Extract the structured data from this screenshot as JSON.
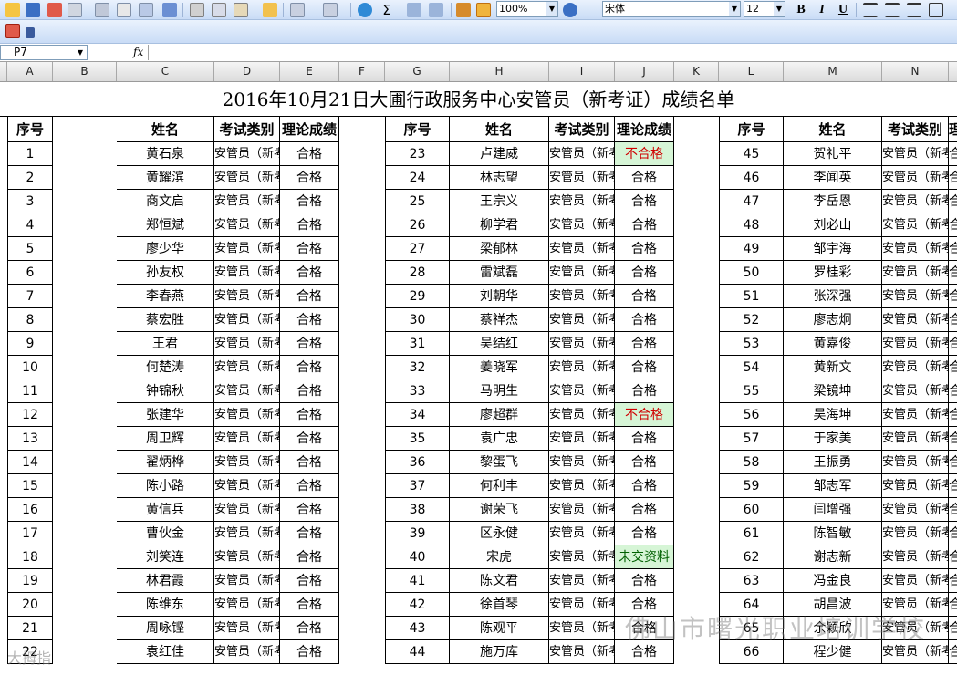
{
  "toolbar": {
    "zoom": "100%",
    "font_name": "宋体",
    "font_size": "12",
    "bold": "B",
    "italic": "I",
    "underline": "U",
    "sum": "Σ"
  },
  "formula_bar": {
    "cell_ref": "P7",
    "fx": "fx",
    "value": ""
  },
  "columns": [
    "A",
    "B",
    "C",
    "D",
    "E",
    "F",
    "G",
    "H",
    "I",
    "J",
    "K",
    "L",
    "M",
    "N"
  ],
  "sheet": {
    "title": "2016年10月21日大圃行政服务中心安管员（新考证）成绩名单",
    "headers": {
      "no": "序号",
      "name": "姓名",
      "category": "考试类别",
      "score": "理论成绩"
    },
    "category": "安管员（新考证）",
    "block1": [
      {
        "no": "1",
        "name": "黄石泉",
        "score": "合格"
      },
      {
        "no": "2",
        "name": "黄耀滨",
        "score": "合格"
      },
      {
        "no": "3",
        "name": "商文启",
        "score": "合格"
      },
      {
        "no": "4",
        "name": "郑恒斌",
        "score": "合格"
      },
      {
        "no": "5",
        "name": "廖少华",
        "score": "合格"
      },
      {
        "no": "6",
        "name": "孙友权",
        "score": "合格"
      },
      {
        "no": "7",
        "name": "李春燕",
        "score": "合格"
      },
      {
        "no": "8",
        "name": "蔡宏胜",
        "score": "合格"
      },
      {
        "no": "9",
        "name": "王君",
        "score": "合格"
      },
      {
        "no": "10",
        "name": "何楚涛",
        "score": "合格"
      },
      {
        "no": "11",
        "name": "钟锦秋",
        "score": "合格"
      },
      {
        "no": "12",
        "name": "张建华",
        "score": "合格"
      },
      {
        "no": "13",
        "name": "周卫辉",
        "score": "合格"
      },
      {
        "no": "14",
        "name": "翟炳桦",
        "score": "合格"
      },
      {
        "no": "15",
        "name": "陈小路",
        "score": "合格"
      },
      {
        "no": "16",
        "name": "黄信兵",
        "score": "合格"
      },
      {
        "no": "17",
        "name": "曹伙金",
        "score": "合格"
      },
      {
        "no": "18",
        "name": "刘笑连",
        "score": "合格"
      },
      {
        "no": "19",
        "name": "林君霞",
        "score": "合格"
      },
      {
        "no": "20",
        "name": "陈维东",
        "score": "合格"
      },
      {
        "no": "21",
        "name": "周咏铿",
        "score": "合格"
      },
      {
        "no": "22",
        "name": "袁红佳",
        "score": "合格"
      }
    ],
    "block2": [
      {
        "no": "23",
        "name": "卢建威",
        "score": "不合格",
        "status": "fail"
      },
      {
        "no": "24",
        "name": "林志望",
        "score": "合格"
      },
      {
        "no": "25",
        "name": "王宗义",
        "score": "合格"
      },
      {
        "no": "26",
        "name": "柳学君",
        "score": "合格"
      },
      {
        "no": "27",
        "name": "梁郁林",
        "score": "合格"
      },
      {
        "no": "28",
        "name": "雷斌磊",
        "score": "合格"
      },
      {
        "no": "29",
        "name": "刘朝华",
        "score": "合格"
      },
      {
        "no": "30",
        "name": "蔡祥杰",
        "score": "合格"
      },
      {
        "no": "31",
        "name": "吴结红",
        "score": "合格"
      },
      {
        "no": "32",
        "name": "姜晓军",
        "score": "合格"
      },
      {
        "no": "33",
        "name": "马明生",
        "score": "合格"
      },
      {
        "no": "34",
        "name": "廖超群",
        "score": "不合格",
        "status": "fail"
      },
      {
        "no": "35",
        "name": "袁广忠",
        "score": "合格"
      },
      {
        "no": "36",
        "name": "黎蛋飞",
        "score": "合格"
      },
      {
        "no": "37",
        "name": "何利丰",
        "score": "合格"
      },
      {
        "no": "38",
        "name": "谢荣飞",
        "score": "合格"
      },
      {
        "no": "39",
        "name": "区永健",
        "score": "合格"
      },
      {
        "no": "40",
        "name": "宋虎",
        "score": "未交资料",
        "status": "pending"
      },
      {
        "no": "41",
        "name": "陈文君",
        "score": "合格"
      },
      {
        "no": "42",
        "name": "徐首琴",
        "score": "合格"
      },
      {
        "no": "43",
        "name": "陈观平",
        "score": "合格"
      },
      {
        "no": "44",
        "name": "施万库",
        "score": "合格"
      }
    ],
    "block3": [
      {
        "no": "45",
        "name": "贺礼平",
        "score": "合格"
      },
      {
        "no": "46",
        "name": "李闻英",
        "score": "合格"
      },
      {
        "no": "47",
        "name": "李岳恩",
        "score": "合格"
      },
      {
        "no": "48",
        "name": "刘必山",
        "score": "合格"
      },
      {
        "no": "49",
        "name": "邹宇海",
        "score": "合格"
      },
      {
        "no": "50",
        "name": "罗桂彩",
        "score": "合格"
      },
      {
        "no": "51",
        "name": "张深强",
        "score": "合格"
      },
      {
        "no": "52",
        "name": "廖志炯",
        "score": "合格"
      },
      {
        "no": "53",
        "name": "黄嘉俊",
        "score": "合格"
      },
      {
        "no": "54",
        "name": "黄新文",
        "score": "合格"
      },
      {
        "no": "55",
        "name": "梁镜坤",
        "score": "合格"
      },
      {
        "no": "56",
        "name": "吴海坤",
        "score": "合格"
      },
      {
        "no": "57",
        "name": "于家美",
        "score": "合格"
      },
      {
        "no": "58",
        "name": "王振勇",
        "score": "合格"
      },
      {
        "no": "59",
        "name": "邹志军",
        "score": "合格"
      },
      {
        "no": "60",
        "name": "闫增强",
        "score": "合格"
      },
      {
        "no": "61",
        "name": "陈智敏",
        "score": "合格"
      },
      {
        "no": "62",
        "name": "谢志新",
        "score": "合格"
      },
      {
        "no": "63",
        "name": "冯金良",
        "score": "合格"
      },
      {
        "no": "64",
        "name": "胡昌波",
        "score": "合格"
      },
      {
        "no": "65",
        "name": "余颖欣",
        "score": "合格"
      },
      {
        "no": "66",
        "name": "程少健",
        "score": "合格"
      }
    ]
  },
  "watermark": {
    "text": "佛山市曙光职业培训学校",
    "corner": "大拇指"
  }
}
